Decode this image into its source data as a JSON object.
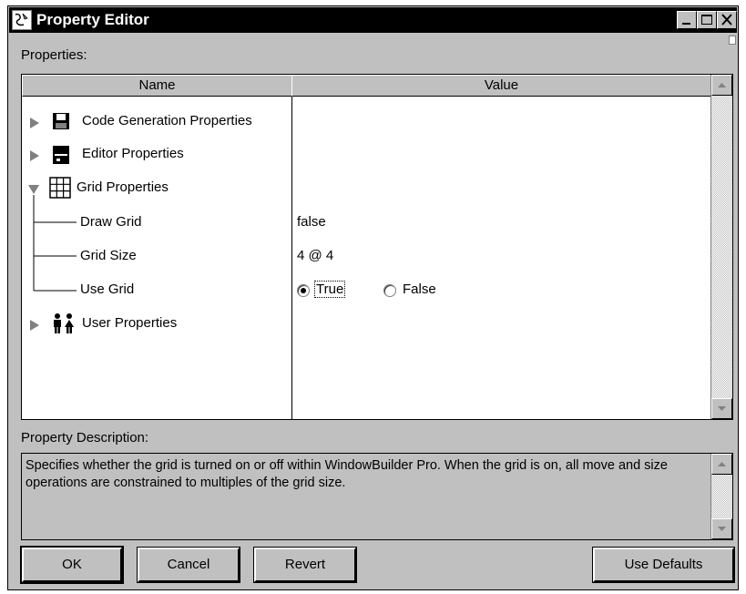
{
  "window": {
    "title": "Property Editor"
  },
  "properties_label": "Properties:",
  "columns": {
    "name": "Name",
    "value": "Value"
  },
  "tree": {
    "code_generation": "Code Generation Properties",
    "editor": "Editor Properties",
    "grid": "Grid Properties",
    "draw_grid": {
      "label": "Draw Grid",
      "value": "false"
    },
    "grid_size": {
      "label": "Grid Size",
      "value": "4 @ 4"
    },
    "use_grid": {
      "label": "Use Grid",
      "option_true": "True",
      "option_false": "False",
      "selected": "True"
    },
    "user": "User Properties"
  },
  "description": {
    "label": "Property Description:",
    "text": "Specifies whether the grid is turned on or off within WindowBuilder Pro. When the grid is on, all move and size operations are constrained to multiples of the grid size."
  },
  "buttons": {
    "ok": "OK",
    "cancel": "Cancel",
    "revert": "Revert",
    "use_defaults": "Use Defaults"
  },
  "icons": {
    "expand": "triangle-right-icon",
    "collapse": "triangle-down-icon",
    "code_gen": "floppy-disk-icon",
    "editor": "editor-window-icon",
    "grid": "grid-icon",
    "user": "users-icon"
  }
}
